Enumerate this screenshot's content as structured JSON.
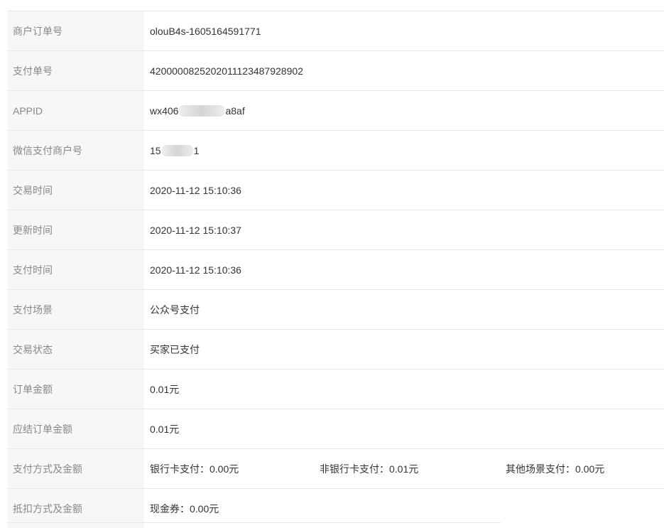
{
  "rows": [
    {
      "label": "商户订单号",
      "value": "olouB4s-1605164591771"
    },
    {
      "label": "支付单号",
      "value": "4200000825202011123487928902"
    },
    {
      "label": "APPID",
      "value_prefix": "wx406",
      "value_suffix": "a8af"
    },
    {
      "label": "微信支付商户号",
      "value_prefix": "15",
      "value_suffix": "1"
    },
    {
      "label": "交易时间",
      "value": "2020-11-12 15:10:36"
    },
    {
      "label": "更新时间",
      "value": "2020-11-12 15:10:37"
    },
    {
      "label": "支付时间",
      "value": "2020-11-12 15:10:36"
    },
    {
      "label": "支付场景",
      "value": "公众号支付"
    },
    {
      "label": "交易状态",
      "value": "买家已支付"
    },
    {
      "label": "订单金额",
      "value": "0.01元"
    },
    {
      "label": "应结订单金额",
      "value": "0.01元"
    },
    {
      "label": "支付方式及金额",
      "items": [
        "银行卡支付：0.00元",
        "非银行卡支付：0.01元",
        "其他场景支付：0.00元"
      ]
    },
    {
      "label": "抵扣方式及金额",
      "value": "现金券：0.00元"
    }
  ]
}
